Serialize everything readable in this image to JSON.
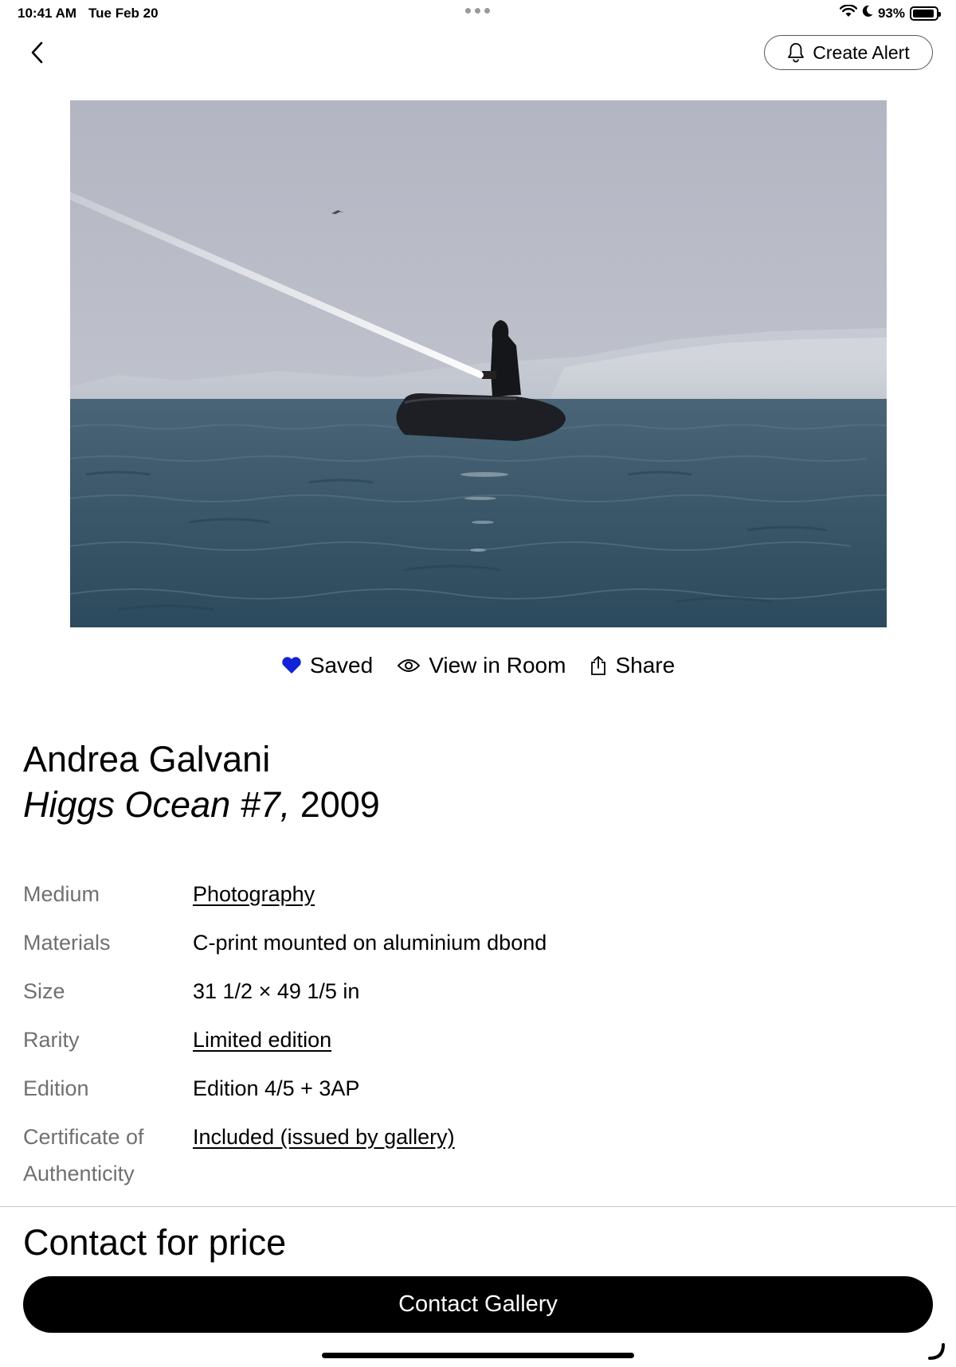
{
  "status_bar": {
    "time": "10:41 AM",
    "date": "Tue Feb 20",
    "battery_text": "93%",
    "battery_level": 0.93
  },
  "nav": {
    "back_icon": "chevron-left-icon",
    "alert_label": "Create Alert",
    "alert_icon": "bell-icon"
  },
  "artwork": {
    "image_description": "figure with searchlight in inflatable boat on grey sea"
  },
  "actions": {
    "saved_label": "Saved",
    "saved_icon": "heart-icon",
    "saved_color": "#1023d7",
    "view_label": "View in Room",
    "view_icon": "eye-icon",
    "share_label": "Share",
    "share_icon": "share-icon"
  },
  "title_block": {
    "artist": "Andrea Galvani",
    "title": "Higgs Ocean #7,",
    "year": "2009"
  },
  "details": [
    {
      "label": "Medium",
      "value": "Photography",
      "link": true
    },
    {
      "label": "Materials",
      "value": "C-print mounted on aluminium dbond",
      "link": false
    },
    {
      "label": "Size",
      "value": "31 1/2 × 49 1/5 in",
      "link": false
    },
    {
      "label": "Rarity",
      "value": "Limited edition",
      "link": true
    },
    {
      "label": "Edition",
      "value": "Edition 4/5 + 3AP",
      "link": false
    },
    {
      "label": "Certificate of Authenticity",
      "value": "Included (issued by gallery)",
      "link": true
    }
  ],
  "footer": {
    "price": "Contact for price",
    "contact_button": "Contact Gallery"
  }
}
